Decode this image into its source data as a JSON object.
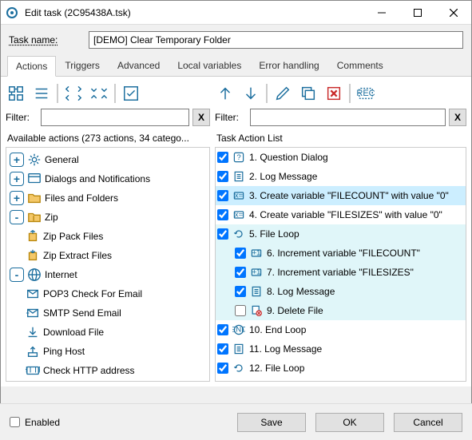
{
  "window": {
    "title": "Edit task (2C95438A.tsk)"
  },
  "task_name": {
    "label": "Task name:",
    "value": "[DEMO] Clear Temporary Folder"
  },
  "tabs": [
    {
      "label": "Actions",
      "active": true
    },
    {
      "label": "Triggers"
    },
    {
      "label": "Advanced"
    },
    {
      "label": "Local variables"
    },
    {
      "label": "Error handling"
    },
    {
      "label": "Comments"
    }
  ],
  "left_panel": {
    "filter_label": "Filter:",
    "filter_value": "",
    "clear_label": "X",
    "header": "Available actions (273 actions, 34 catego...",
    "tree": [
      {
        "toggle": "+",
        "icon": "gear",
        "label": "General"
      },
      {
        "toggle": "+",
        "icon": "dialog",
        "label": "Dialogs and Notifications"
      },
      {
        "toggle": "+",
        "icon": "folder",
        "label": "Files and Folders"
      },
      {
        "toggle": "-",
        "icon": "zip",
        "label": "Zip",
        "children": [
          {
            "icon": "zip-pack",
            "label": "Zip Pack Files"
          },
          {
            "icon": "zip-extract",
            "label": "Zip Extract Files"
          }
        ]
      },
      {
        "toggle": "-",
        "icon": "globe",
        "label": "Internet",
        "children": [
          {
            "icon": "mail-in",
            "label": "POP3 Check For Email"
          },
          {
            "icon": "mail-out",
            "label": "SMTP Send Email"
          },
          {
            "icon": "download",
            "label": "Download File"
          },
          {
            "icon": "ping",
            "label": "Ping Host"
          },
          {
            "icon": "http",
            "label": "Check HTTP address"
          }
        ]
      }
    ]
  },
  "right_panel": {
    "filter_label": "Filter:",
    "filter_value": "",
    "clear_label": "X",
    "header": "Task Action List",
    "actions": [
      {
        "num": "1.",
        "label": "Question Dialog",
        "checked": true,
        "icon": "question"
      },
      {
        "num": "2.",
        "label": "Log Message",
        "checked": true,
        "icon": "log"
      },
      {
        "num": "3.",
        "label": "Create variable \"FILECOUNT\" with value \"0\"",
        "checked": true,
        "icon": "var",
        "selected": true
      },
      {
        "num": "4.",
        "label": "Create variable \"FILESIZES\" with value \"0\"",
        "checked": true,
        "icon": "var"
      },
      {
        "num": "5.",
        "label": "File Loop",
        "checked": true,
        "icon": "loop",
        "highlight": true
      },
      {
        "num": "6.",
        "label": "Increment variable \"FILECOUNT\"",
        "checked": true,
        "icon": "inc",
        "indent": 1,
        "highlight": true
      },
      {
        "num": "7.",
        "label": "Increment variable \"FILESIZES\"",
        "checked": true,
        "icon": "inc",
        "indent": 1,
        "highlight": true
      },
      {
        "num": "8.",
        "label": "Log Message",
        "checked": true,
        "icon": "log",
        "indent": 1,
        "highlight": true
      },
      {
        "num": "9.",
        "label": "Delete File",
        "checked": false,
        "icon": "delete",
        "indent": 1,
        "highlight": true
      },
      {
        "num": "10.",
        "label": "End Loop",
        "checked": true,
        "icon": "end"
      },
      {
        "num": "11.",
        "label": "Log Message",
        "checked": true,
        "icon": "log"
      },
      {
        "num": "12.",
        "label": "File Loop",
        "checked": true,
        "icon": "loop"
      }
    ]
  },
  "bottom": {
    "enabled_label": "Enabled",
    "enabled_checked": false,
    "save": "Save",
    "ok": "OK",
    "cancel": "Cancel"
  }
}
